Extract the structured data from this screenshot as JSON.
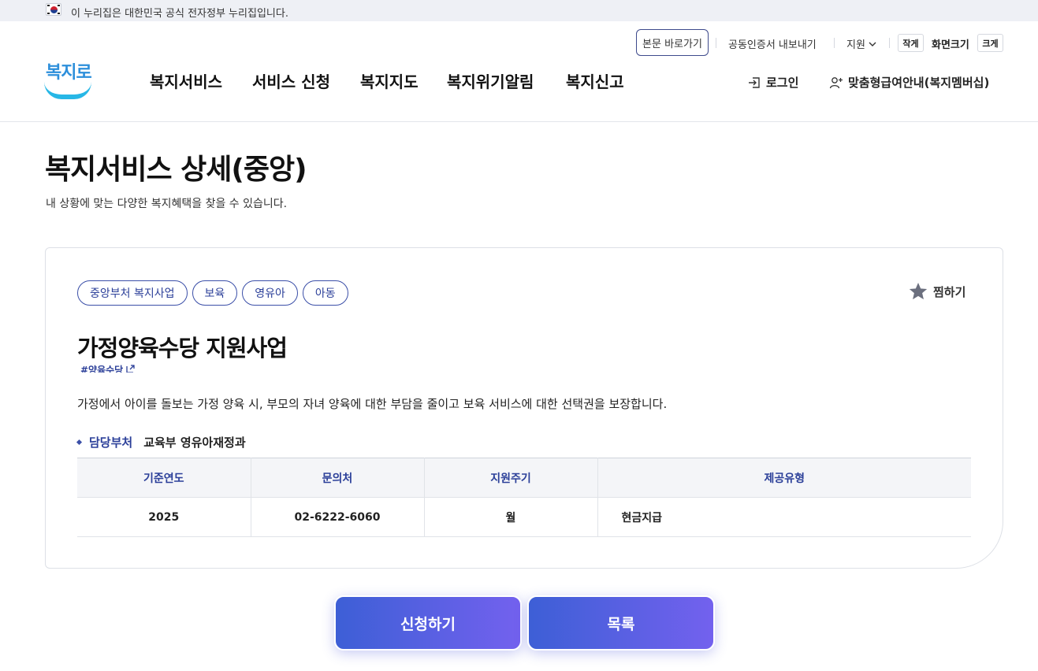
{
  "gov_bar": {
    "text": "이 누리집은 대한민국 공식 전자정부 누리집입니다."
  },
  "utility": {
    "skip": "본문 바로가기",
    "cert": "공동인증서 내보내기",
    "support": "지원",
    "small": "작게",
    "font_size": "화면크기",
    "large": "크게"
  },
  "logo": {
    "text": "복지로"
  },
  "gnb": [
    {
      "label": "복지서비스"
    },
    {
      "label": "서비스 신청"
    },
    {
      "label": "복지지도"
    },
    {
      "label": "복지위기알림"
    },
    {
      "label": "복지신고"
    }
  ],
  "header_actions": {
    "login": "로그인",
    "member": "맞춤형급여안내(복지멤버십)"
  },
  "page": {
    "title": "복지서비스 상세(중앙)",
    "desc": "내 상황에 맞는 다양한 복지혜택을 찾을 수 있습니다."
  },
  "card": {
    "tags": [
      "중앙부처 복지사업",
      "보육",
      "영유아",
      "아동"
    ],
    "bookmark": "찜하기",
    "title": "가정양육수당 지원사업",
    "hashtag": "#양육수당",
    "desc": "가정에서 아이를 돌보는 가정 양육 시, 부모의 자녀 양육에 대한 부담을 줄이고 보육 서비스에 대한 선택권을 보장합니다.",
    "dept_label": "담당부처",
    "dept_value": "교육부 영유아재정과",
    "table": {
      "headers": [
        "기준연도",
        "문의처",
        "지원주기",
        "제공유형"
      ],
      "row": [
        "2025",
        "02-6222-6060",
        "월",
        "현금지급"
      ]
    }
  },
  "buttons": {
    "apply": "신청하기",
    "list": "목록"
  },
  "colors": {
    "brand": "#2b3f99",
    "button_from": "#3d5fd6",
    "button_to": "#7361ee"
  }
}
